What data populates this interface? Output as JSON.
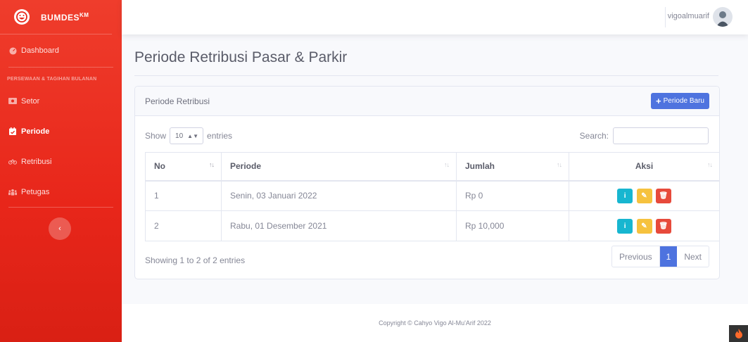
{
  "brand": {
    "name": "BUMDES",
    "sup": "KM"
  },
  "sidebar": {
    "dashboard": "Dashboard",
    "section_heading": "PERSEWAAN & TAGIHAN BULANAN",
    "items": [
      {
        "label": "Setor",
        "icon": "money-icon"
      },
      {
        "label": "Periode",
        "icon": "calendar-icon"
      },
      {
        "label": "Retribusi",
        "icon": "bicycle-icon"
      },
      {
        "label": "Petugas",
        "icon": "users-icon"
      }
    ],
    "toggle": "‹"
  },
  "topbar": {
    "user_name": "vigoalmuarif"
  },
  "page": {
    "title": "Periode Retribusi Pasar & Parkir"
  },
  "card": {
    "title": "Periode Retribusi",
    "new_button": "Periode Baru",
    "show_label": "Show",
    "entries_value": "10",
    "entries_label": "entries",
    "search_label": "Search:",
    "search_value": "",
    "columns": [
      "No",
      "Periode",
      "Jumlah",
      "Aksi"
    ],
    "rows": [
      {
        "no": "1",
        "periode": "Senin, 03 Januari 2022",
        "jumlah": "Rp 0"
      },
      {
        "no": "2",
        "periode": "Rabu, 01 Desember 2021",
        "jumlah": "Rp 10,000"
      }
    ],
    "info": "Showing 1 to 2 of 2 entries",
    "pagination": {
      "previous": "Previous",
      "current": "1",
      "next": "Next"
    }
  },
  "footer": {
    "copyright": "Copyright © Cahyo Vigo Al-Mu'Arif 2022"
  },
  "colors": {
    "sidebar": "#e8261a",
    "primary": "#4e73df",
    "info": "#17b6d0",
    "warning": "#f6c23e",
    "danger": "#e74a3b"
  }
}
